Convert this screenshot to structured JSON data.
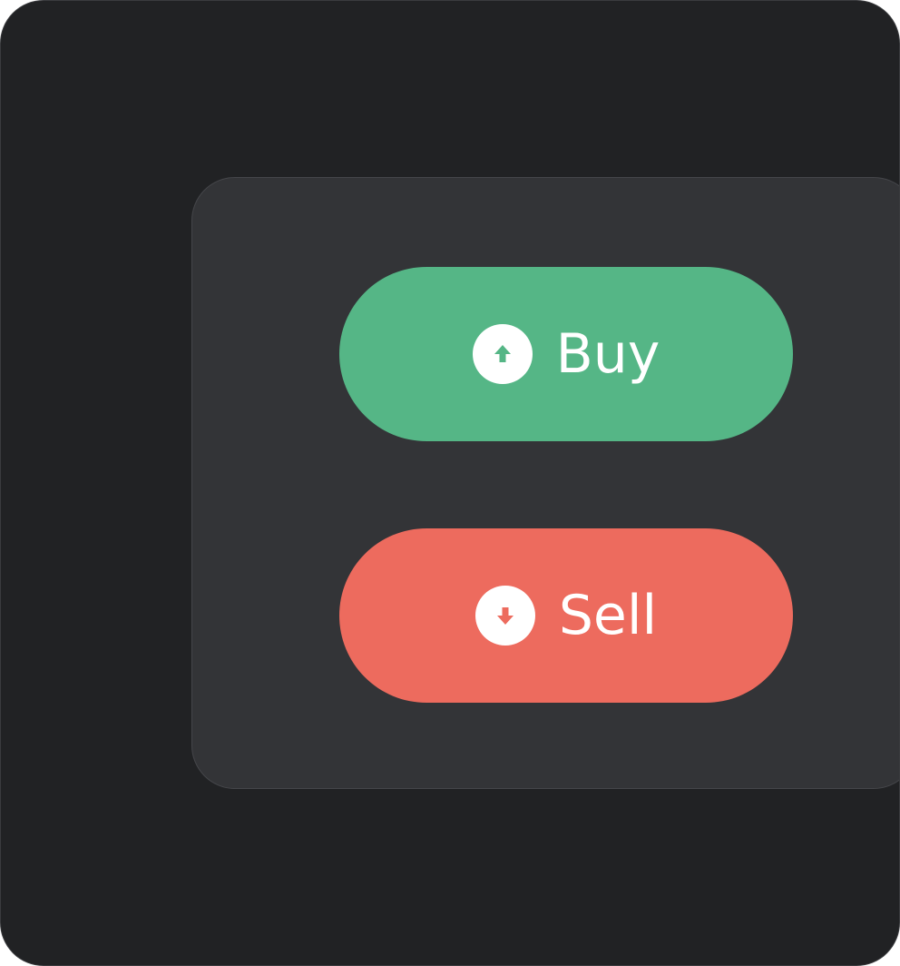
{
  "actions": {
    "buy": {
      "label": "Buy",
      "icon": "arrow-up-circle-icon",
      "color": "#55b686"
    },
    "sell": {
      "label": "Sell",
      "icon": "arrow-down-circle-icon",
      "color": "#ed6b5e"
    }
  },
  "colors": {
    "background": "#212224",
    "panel": "#333437"
  }
}
